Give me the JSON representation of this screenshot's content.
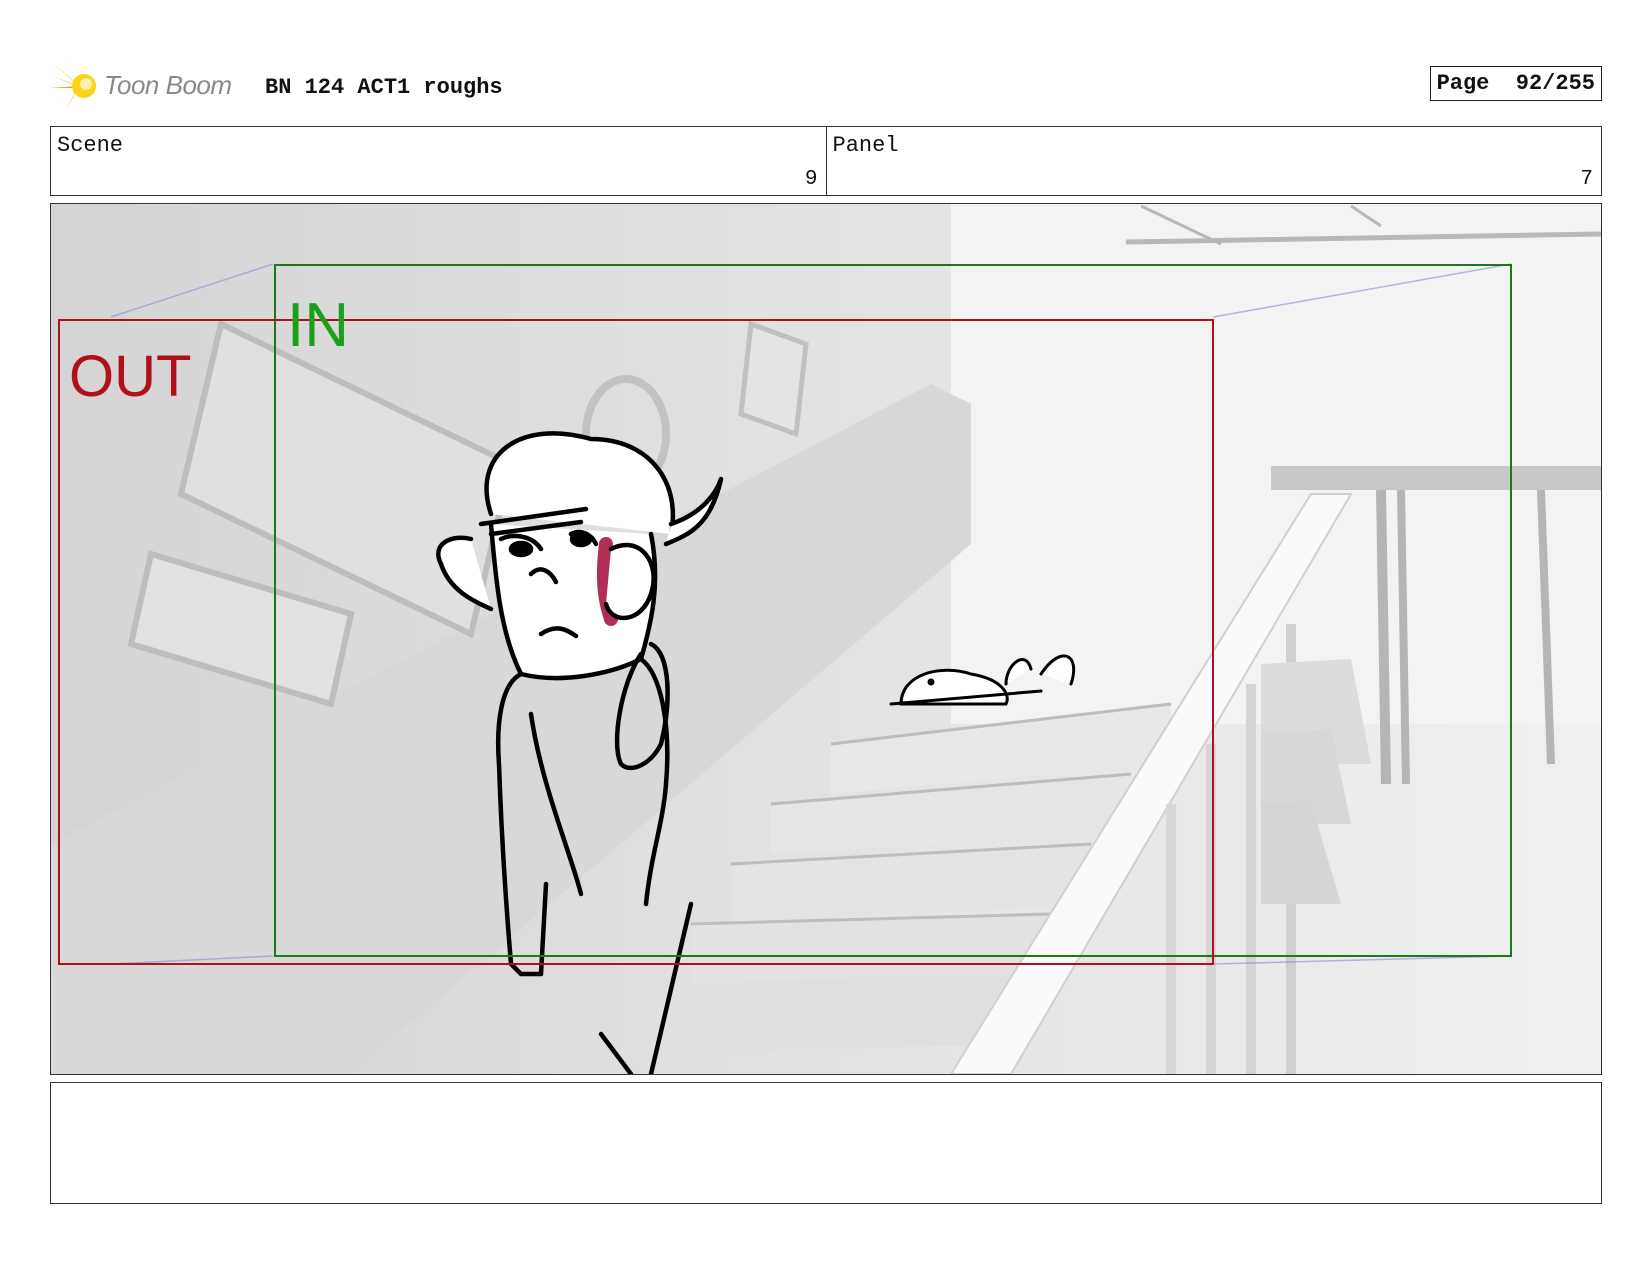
{
  "header": {
    "logo_text": "Toon Boom",
    "doc_title": "BN 124 ACT1 roughs",
    "page_label": "Page",
    "page_value": "92/255"
  },
  "info": {
    "scene_label": "Scene",
    "scene_value": "9",
    "panel_label": "Panel",
    "panel_value": "7"
  },
  "frame": {
    "in_label": "IN",
    "out_label": "OUT",
    "in_color": "#1a7a1a",
    "out_color": "#b0101a"
  },
  "notes": {
    "text": ""
  }
}
